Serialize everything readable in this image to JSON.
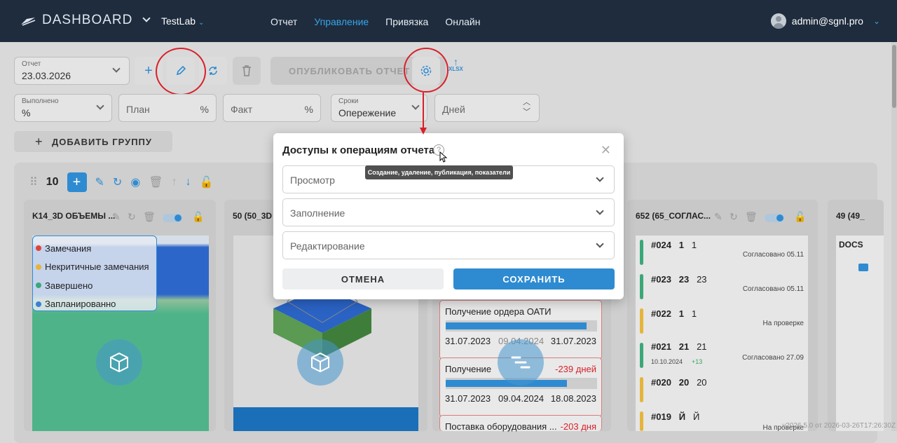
{
  "nav": {
    "app_title": "DASHBOARD",
    "project": "TestLab",
    "menu": [
      "Отчет",
      "Управление",
      "Привязка",
      "Онлайн"
    ],
    "active_menu": "Управление",
    "user": "admin@sgnl.pro"
  },
  "filters": {
    "report_label": "Отчет",
    "report_value": "23.03.2026",
    "done_label": "Выполнено",
    "done_value": "%",
    "plan_placeholder": "План",
    "plan_suffix": "%",
    "fact_placeholder": "Факт",
    "fact_suffix": "%",
    "terms_label": "Сроки",
    "terms_value": "Опережение",
    "days_placeholder": "Дней"
  },
  "toolbar": {
    "publish_label": "ОПУБЛИКОВАТЬ ОТЧЕТ",
    "xlsx_label": "XLSX",
    "add_group_label": "ДОБАВИТЬ ГРУППУ",
    "group_count": "10"
  },
  "cards": {
    "c1_title": "K14_3D ОБЪЕМЫ ...",
    "c2_title": "50 (50_3D",
    "c4_title": "652 (65_СОГЛАС...",
    "c5_title": "49 (49_",
    "c5_docs": "DOCS"
  },
  "legend": [
    {
      "label": "Замечания",
      "color": "#e0433a"
    },
    {
      "label": "Некритичные замечания",
      "color": "#e6b43a"
    },
    {
      "label": "Завершено",
      "color": "#3aa876"
    },
    {
      "label": "Запланированно",
      "color": "#3d7fd1"
    }
  ],
  "tasks": [
    {
      "title": "Получение ордера ОАТИ",
      "late": "",
      "d1": "31.07.2023",
      "d2": "09.04.2024",
      "d3": "31.07.2023",
      "progress": 0.93
    },
    {
      "title": "Получение",
      "late": "-239 дней",
      "d1": "31.07.2023",
      "d2": "09.04.2024",
      "d3": "18.08.2023",
      "progress": 0.8
    },
    {
      "title": "Поставка оборудования ...",
      "late": "-203 дня",
      "d1": "",
      "d2": "",
      "d3": "",
      "progress": 0
    }
  ],
  "items": [
    {
      "code": "#024",
      "a": "1",
      "b": "1",
      "status": "Согласовано 05.11",
      "color": "#3aa876",
      "sub": "",
      "sub2": ""
    },
    {
      "code": "#023",
      "a": "23",
      "b": "23",
      "status": "Согласовано 05.11",
      "color": "#3aa876",
      "sub": "",
      "sub2": ""
    },
    {
      "code": "#022",
      "a": "1",
      "b": "1",
      "status": "На проверке",
      "color": "#e6b43a",
      "sub": "",
      "sub2": ""
    },
    {
      "code": "#021",
      "a": "21",
      "b": "21",
      "status": "Согласовано 27.09",
      "color": "#3aa876",
      "sub": "10.10.2024",
      "sub2": "+13"
    },
    {
      "code": "#020",
      "a": "20",
      "b": "20",
      "status": "",
      "color": "#e6b43a",
      "sub": "",
      "sub2": ""
    },
    {
      "code": "#019",
      "a": "Й",
      "b": "Й",
      "status": "На проверке",
      "color": "#e6b43a",
      "sub": "",
      "sub2": ""
    }
  ],
  "modal": {
    "title": "Доступы к операциям отчета",
    "help_glyph": "?",
    "tooltip": "Создание, удаление, публикация, показатели",
    "options": [
      "Просмотр",
      "Заполнение",
      "Редактирование"
    ],
    "cancel_label": "ОТМЕНА",
    "save_label": "СОХРАНИТЬ"
  },
  "version": "v2026.5.0 от 2026-03-26T17:26:30Z"
}
